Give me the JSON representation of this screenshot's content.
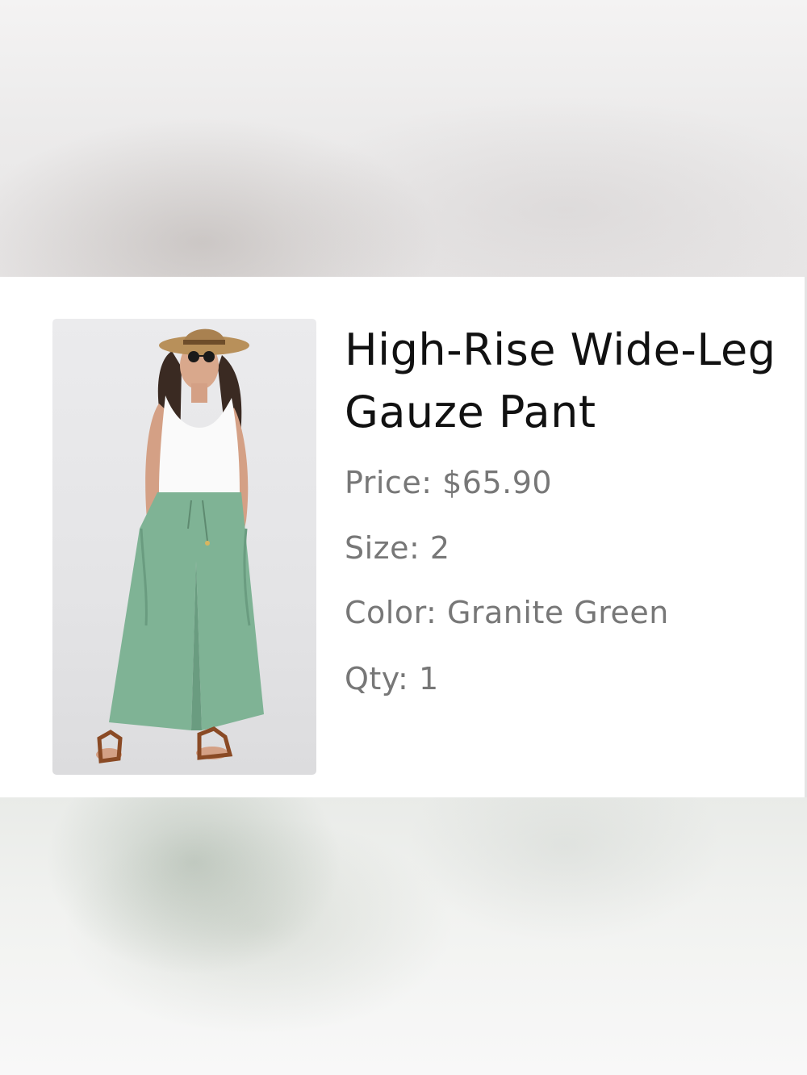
{
  "product": {
    "title": "High-Rise Wide-Leg Gauze Pant",
    "image_alt": "Model wearing green wide-leg gauze pants, white tank top, straw hat and sandals",
    "details": {
      "price_label": "Price:",
      "price_value": "$65.90",
      "size_label": "Size:",
      "size_value": "2",
      "color_label": "Color:",
      "color_value": "Granite Green",
      "qty_label": "Qty:",
      "qty_value": "1"
    }
  },
  "colors": {
    "title_text": "#111111",
    "detail_text": "#777777",
    "pant_green": "#7fb395"
  }
}
